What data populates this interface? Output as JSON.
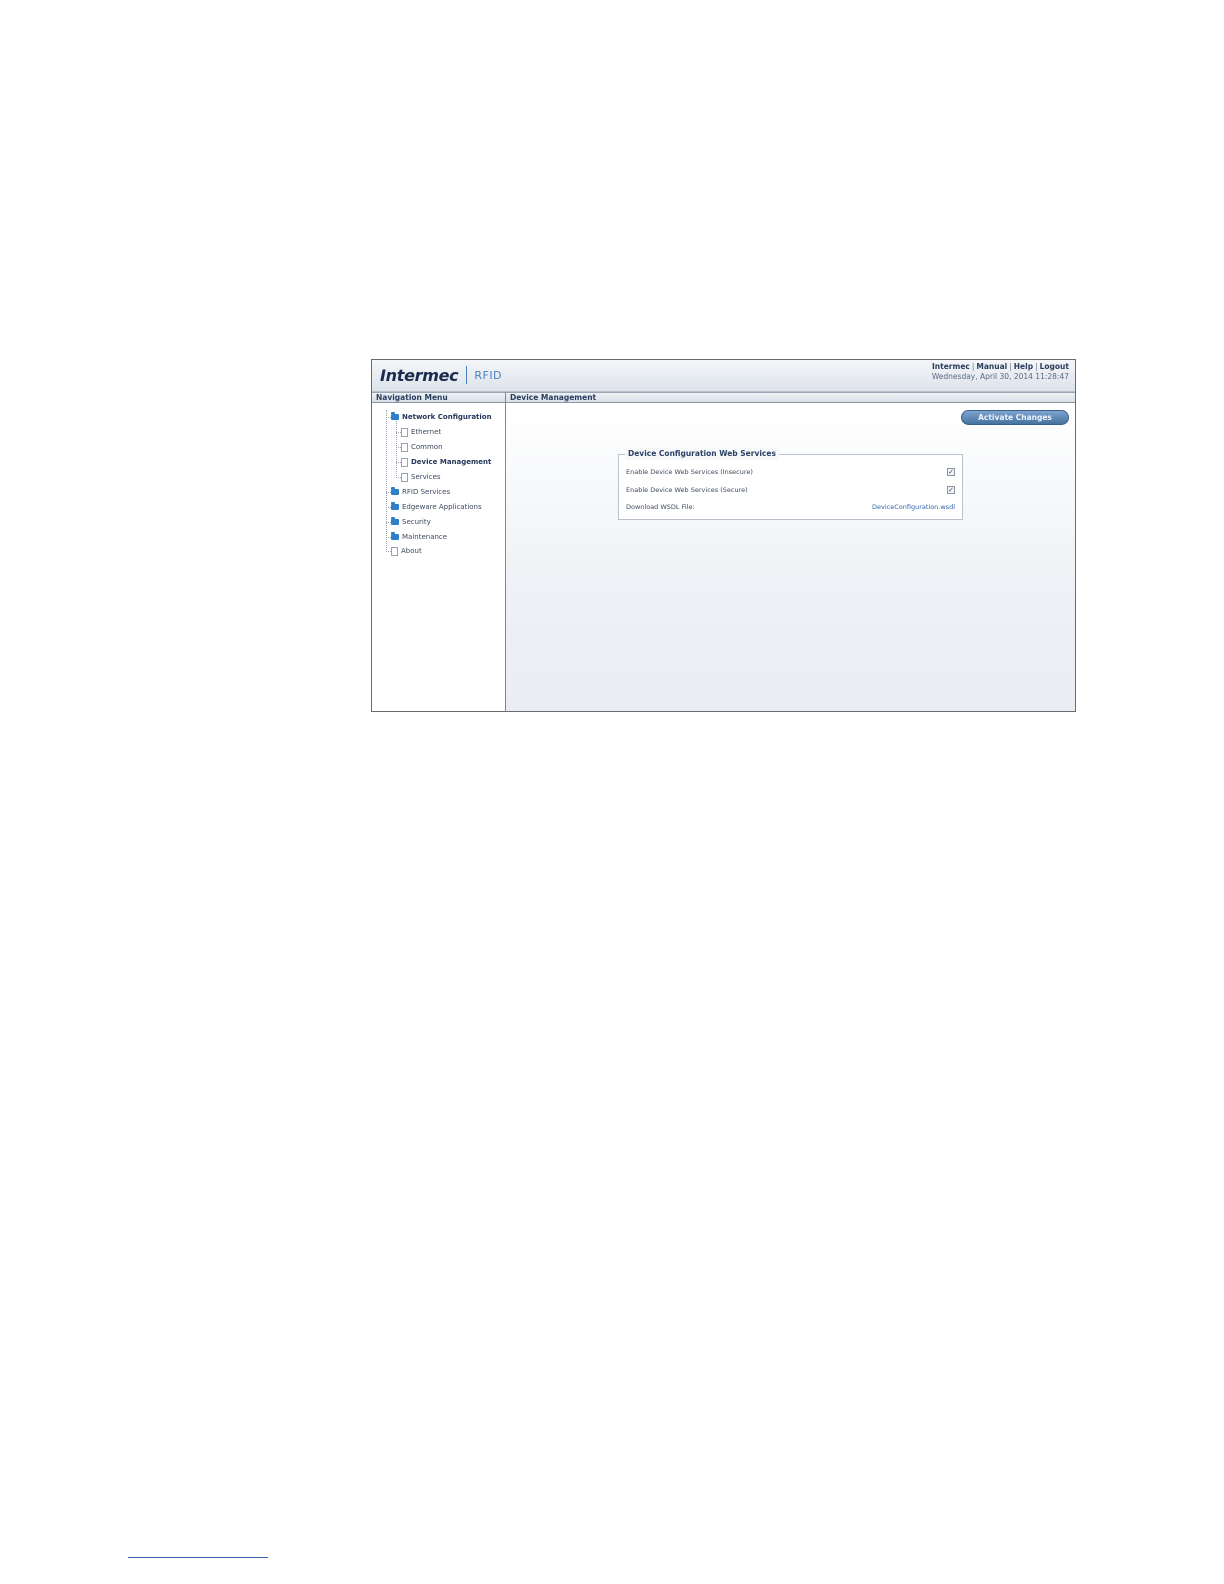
{
  "header": {
    "brand": "Intermec",
    "product": "RFID",
    "links": [
      "Intermec",
      "Manual",
      "Help",
      "Logout"
    ],
    "datetime": "Wednesday, April 30, 2014 11:28:47"
  },
  "nav": {
    "title": "Navigation Menu",
    "items": [
      {
        "label": "Network Configuration",
        "type": "folder"
      },
      {
        "label": "Ethernet",
        "type": "page"
      },
      {
        "label": "Common",
        "type": "page"
      },
      {
        "label": "Device Management",
        "type": "page"
      },
      {
        "label": "Services",
        "type": "page"
      },
      {
        "label": "RFID Services",
        "type": "folder"
      },
      {
        "label": "Edgeware Applications",
        "type": "folder"
      },
      {
        "label": "Security",
        "type": "folder"
      },
      {
        "label": "Maintenance",
        "type": "folder"
      },
      {
        "label": "About",
        "type": "page"
      }
    ]
  },
  "main": {
    "title": "Device Management",
    "activate_label": "Activate Changes",
    "section": {
      "legend": "Device Configuration Web Services",
      "rows": [
        {
          "label": "Enable Device Web Services (Insecure)",
          "checked": true
        },
        {
          "label": "Enable Device Web Services (Secure)",
          "checked": true
        },
        {
          "label": "Download WSDL File:",
          "link": "DeviceConfiguration.wsdl"
        }
      ]
    }
  },
  "icons": {
    "folder": "folder-icon",
    "page": "document-icon",
    "check": "checkmark-icon"
  },
  "colors": {
    "accent": "#2f7fc8",
    "header_text": "#1b2b4f",
    "button": "#46729f"
  }
}
